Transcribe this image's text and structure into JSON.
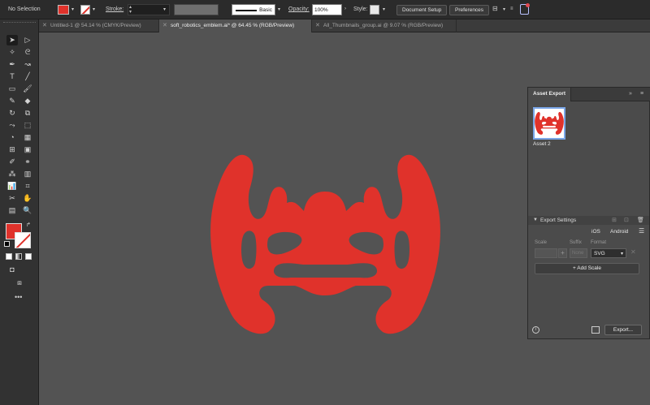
{
  "control_bar": {
    "selection_status": "No Selection",
    "stroke_label": "Stroke:",
    "brush_label": "Basic",
    "opacity_label": "Opacity:",
    "opacity_value": "100%",
    "style_label": "Style:",
    "document_setup_label": "Document Setup",
    "preferences_label": "Preferences",
    "fill_color": "#e0322b"
  },
  "tabs": [
    {
      "label": "Untitled-1 @ 54.14 % (CMYK/Preview)",
      "active": false
    },
    {
      "label": "soft_robotics_emblem.ai* @ 64.45 % (RGB/Preview)",
      "active": true
    },
    {
      "label": "All_Thumbnails_group.ai @ 9.07 % (RGB/Preview)",
      "active": false
    }
  ],
  "canvas": {
    "artwork_color": "#e0322b",
    "background_color": "#535353"
  },
  "asset_export": {
    "title": "Asset Export",
    "asset_name": "Asset 2",
    "export_settings_title": "Export Settings",
    "presets": [
      "iOS",
      "Android"
    ],
    "columns": {
      "scale": "Scale",
      "suffix": "Suffix",
      "format": "Format"
    },
    "suffix_placeholder": "None",
    "format_value": "SVG",
    "add_scale_label": "Add Scale",
    "export_button_label": "Export..."
  }
}
